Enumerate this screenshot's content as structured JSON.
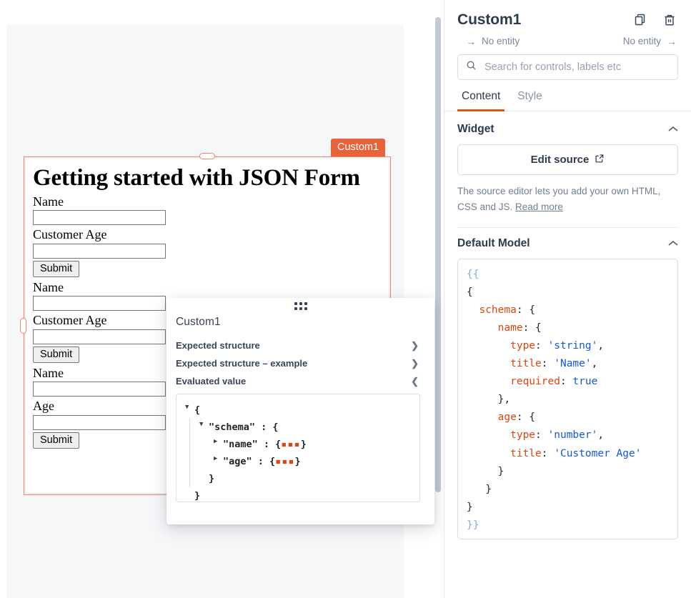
{
  "canvas": {
    "widget": {
      "badge_label": "Custom1",
      "title": "Getting started with JSON Form",
      "groups": [
        {
          "fields": [
            {
              "label": "Name",
              "value": ""
            },
            {
              "label": "Customer Age",
              "value": ""
            }
          ],
          "submit_label": "Submit"
        },
        {
          "fields": [
            {
              "label": "Name",
              "value": ""
            },
            {
              "label": "Customer Age",
              "value": ""
            }
          ],
          "submit_label": "Submit"
        },
        {
          "fields": [
            {
              "label": "Name",
              "value": ""
            },
            {
              "label": "Age",
              "value": ""
            }
          ],
          "submit_label": "Submit"
        }
      ]
    },
    "selection_color": "#F0836A",
    "badge_color": "#E8633A"
  },
  "popover": {
    "title": "Custom1",
    "rows": [
      {
        "label": "Expected structure",
        "state": "collapsed"
      },
      {
        "label": "Expected structure – example",
        "state": "collapsed"
      },
      {
        "label": "Evaluated value",
        "state": "expanded"
      }
    ],
    "evaluated_value": {
      "line1_brace": "{",
      "line2_key": "\"schema\"",
      "line2_colon": " : {",
      "line3_key": "\"name\"",
      "line3_colon": " : {",
      "line3_ellipsis": "▪▪▪",
      "line3_close": "}",
      "line4_key": "\"age\"",
      "line4_colon": " : {",
      "line4_ellipsis": "▪▪▪",
      "line4_close": "}",
      "line5_close": "}",
      "line6_close": "}"
    }
  },
  "panel": {
    "title": "Custom1",
    "icons": {
      "copy": "copy-icon",
      "delete": "trash-icon"
    },
    "entity": {
      "incoming_label": "No entity",
      "outgoing_label": "No entity",
      "incoming_arrow": "→",
      "outgoing_arrow": "→"
    },
    "search": {
      "placeholder": "Search for controls, labels etc",
      "value": "",
      "icon": "search-icon"
    },
    "tabs": [
      {
        "label": "Content",
        "active": true
      },
      {
        "label": "Style",
        "active": false
      }
    ],
    "accent_color": "#E15615",
    "sections": {
      "widget": {
        "title": "Widget",
        "caret": "⌃",
        "edit_source_label": "Edit source",
        "edit_source_icon": "external-link-icon",
        "help_text": "The source editor lets you add your own HTML, CSS and JS. ",
        "help_link": "Read more"
      },
      "default_model": {
        "title": "Default Model",
        "caret": "⌃",
        "code": {
          "l1": "{{",
          "l2": "{",
          "l3_key": "schema",
          "l3_rest": ": {",
          "l4_key": "name",
          "l4_rest": ": {",
          "l5_key": "type",
          "l5_val": "'string'",
          "l6_key": "title",
          "l6_val": "'Name'",
          "l7_key": "required",
          "l7_val": "true",
          "l8": "},",
          "l9_key": "age",
          "l9_rest": ": {",
          "l10_key": "type",
          "l10_val": "'number'",
          "l11_key": "title",
          "l11_val": "'Customer Age'",
          "l12": "}",
          "l13": "}",
          "l14": "}",
          "l15": "}}"
        }
      }
    }
  }
}
